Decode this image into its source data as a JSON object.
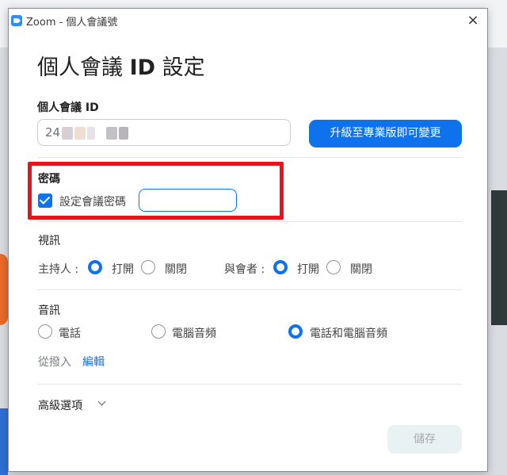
{
  "window": {
    "title": "Zoom - 個人會議號",
    "close_symbol": "×"
  },
  "heading": {
    "prefix": "個人會議 ",
    "id": "ID",
    "suffix": " 設定"
  },
  "meeting_id": {
    "label": "個人會議 ID",
    "value_visible": "24",
    "upgrade_button": "升級至專業版即可變更"
  },
  "password": {
    "section_label": "密碼",
    "checkbox_label": "設定會議密碼",
    "checked": true,
    "input_value": ""
  },
  "video": {
    "section_label": "視訊",
    "host_label": "主持人 :",
    "participants_label": "與會者 :",
    "on_label": "打開",
    "off_label": "關閉",
    "host_selected": "on",
    "participants_selected": "on"
  },
  "audio": {
    "section_label": "音訊",
    "options": [
      "電話",
      "電腦音頻",
      "電話和電腦音頻"
    ],
    "selected_index": 2,
    "dial_in_label": "從撥入",
    "edit_link": "編輯"
  },
  "advanced": {
    "label": "高級選項",
    "icon": "chevron-down-icon"
  },
  "footer": {
    "save_button": "儲存"
  },
  "colors": {
    "accent": "#0e72ed",
    "highlight": "#e8131d"
  }
}
